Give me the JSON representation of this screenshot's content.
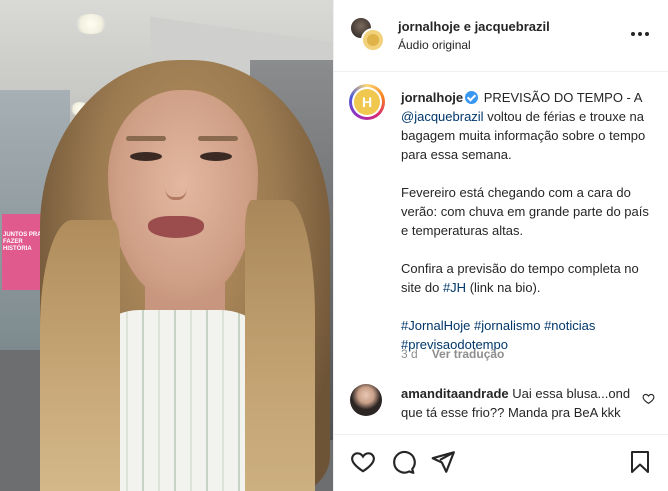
{
  "header": {
    "users": "jornalhoje e jacquebrazil",
    "audio": "Áudio original"
  },
  "media": {
    "poster_text": "JUNTOS PRA FAZER HISTÓRIA"
  },
  "caption": {
    "username": "jornalhoje",
    "line1": "PREVISÃO DO TEMPO - A",
    "mention": "@jacquebrazil",
    "line1b": "voltou de férias e trouxe na bagagem muita informação sobre o tempo para essa semana.",
    "para2": "Fevereiro está chegando com a cara do verão: com chuva em grande parte do país e temperaturas altas.",
    "para3a": "Confira a previsão do tempo completa no site do",
    "para3_tag": "#JH",
    "para3b": "(link na bio).",
    "hashtags": "#JornalHoje #jornalismo #noticias #previsaodotempo",
    "age": "3 d",
    "translate": "Ver tradução"
  },
  "comment": {
    "username": "amanditaandrade",
    "text": "Uai essa blusa...ond que tá esse frio?? Manda pra BeA kkk"
  },
  "icons": [
    "heart-icon",
    "comment-icon",
    "share-icon",
    "bookmark-icon",
    "more-icon",
    "verified-icon"
  ],
  "colors": {
    "link": "#00376b",
    "verified": "#3897f0",
    "text": "#262626",
    "muted": "#8e8e8e"
  }
}
